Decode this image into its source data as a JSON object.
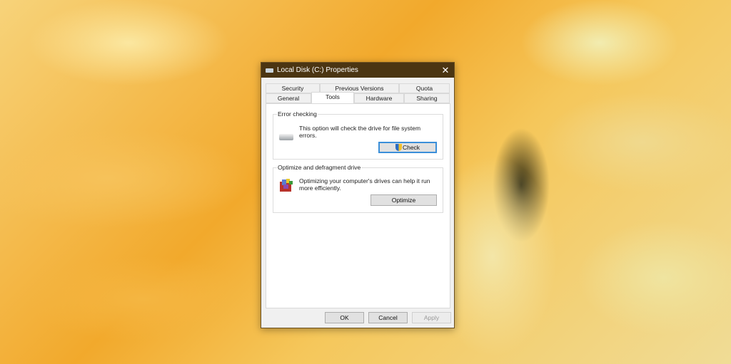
{
  "window": {
    "title": "Local Disk (C:) Properties",
    "close": "✕"
  },
  "tabs": {
    "row1": [
      "Security",
      "Previous Versions",
      "Quota"
    ],
    "row2": [
      "General",
      "Tools",
      "Hardware",
      "Sharing"
    ],
    "active": "Tools"
  },
  "error_checking": {
    "heading": "Error checking",
    "text": "This option will check the drive for file system errors.",
    "button": "Check"
  },
  "optimize": {
    "heading": "Optimize and defragment drive",
    "text": "Optimizing your computer's drives can help it run more efficiently.",
    "button": "Optimize"
  },
  "footer": {
    "ok": "OK",
    "cancel": "Cancel",
    "apply": "Apply"
  }
}
